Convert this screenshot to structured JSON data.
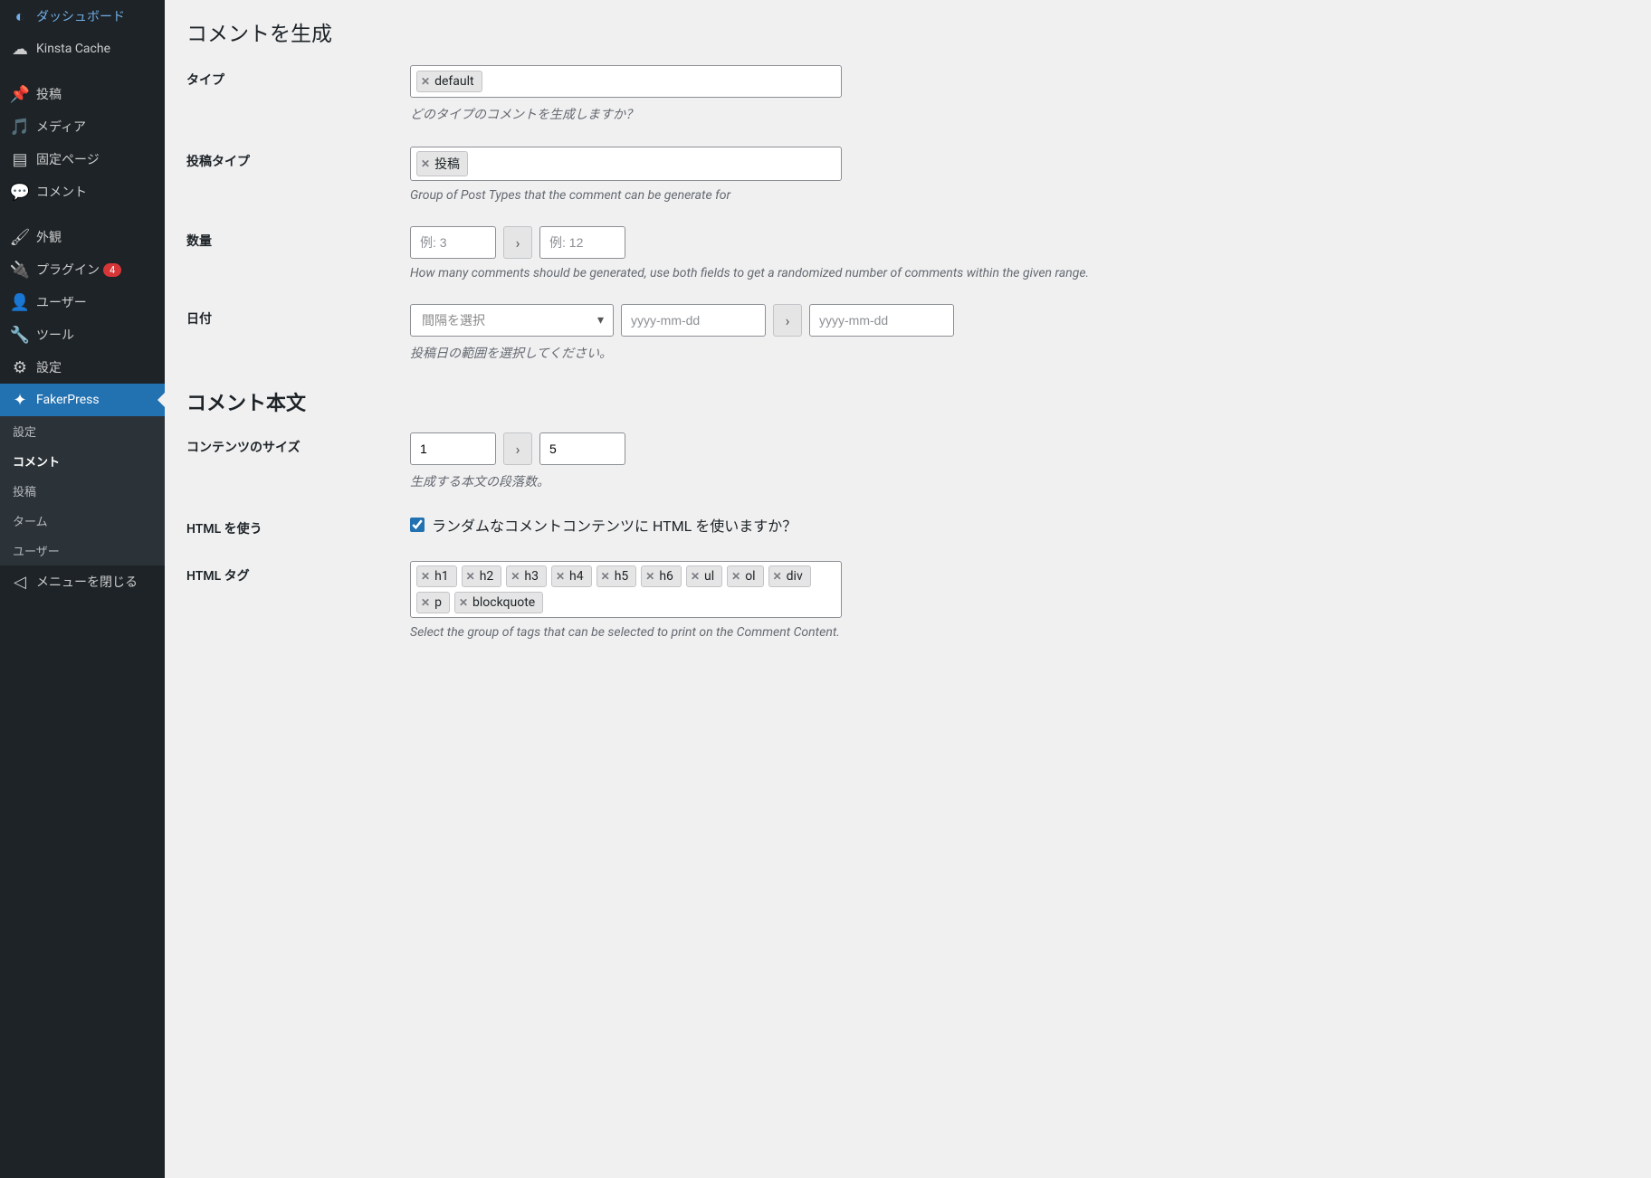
{
  "sidebar": {
    "dashboard": "ダッシュボード",
    "kinsta_cache": "Kinsta Cache",
    "posts": "投稿",
    "media": "メディア",
    "pages": "固定ページ",
    "comments": "コメント",
    "appearance": "外観",
    "plugins": "プラグイン",
    "plugins_badge": "4",
    "users": "ユーザー",
    "tools": "ツール",
    "settings": "設定",
    "fakerpress": "FakerPress",
    "sub": {
      "settings": "設定",
      "comments": "コメント",
      "posts": "投稿",
      "terms": "ターム",
      "users": "ユーザー"
    },
    "collapse": "メニューを閉じる"
  },
  "page": {
    "title": "コメントを生成",
    "type": {
      "label": "タイプ",
      "tag": "default",
      "desc": "どのタイプのコメントを生成しますか？"
    },
    "post_type": {
      "label": "投稿タイプ",
      "tag": "投稿",
      "desc": "Group of Post Types that the comment can be generate for"
    },
    "qty": {
      "label": "数量",
      "min_ph": "例: 3",
      "max_ph": "例: 12",
      "desc": "How many comments should be generated, use both fields to get a randomized number of comments within the given range."
    },
    "date": {
      "label": "日付",
      "select_ph": "間隔を選択",
      "from_ph": "yyyy-mm-dd",
      "to_ph": "yyyy-mm-dd",
      "desc": "投稿日の範囲を選択してください。"
    },
    "section2": "コメント本文",
    "content_size": {
      "label": "コンテンツのサイズ",
      "min": "1",
      "max": "5",
      "desc": "生成する本文の段落数。"
    },
    "use_html": {
      "label": "HTML を使う",
      "desc": "ランダムなコメントコンテンツに HTML を使いますか？"
    },
    "html_tags": {
      "label": "HTML タグ",
      "tags": [
        "h1",
        "h2",
        "h3",
        "h4",
        "h5",
        "h6",
        "ul",
        "ol",
        "div",
        "p",
        "blockquote"
      ],
      "desc": "Select the group of tags that can be selected to print on the Comment Content."
    }
  }
}
